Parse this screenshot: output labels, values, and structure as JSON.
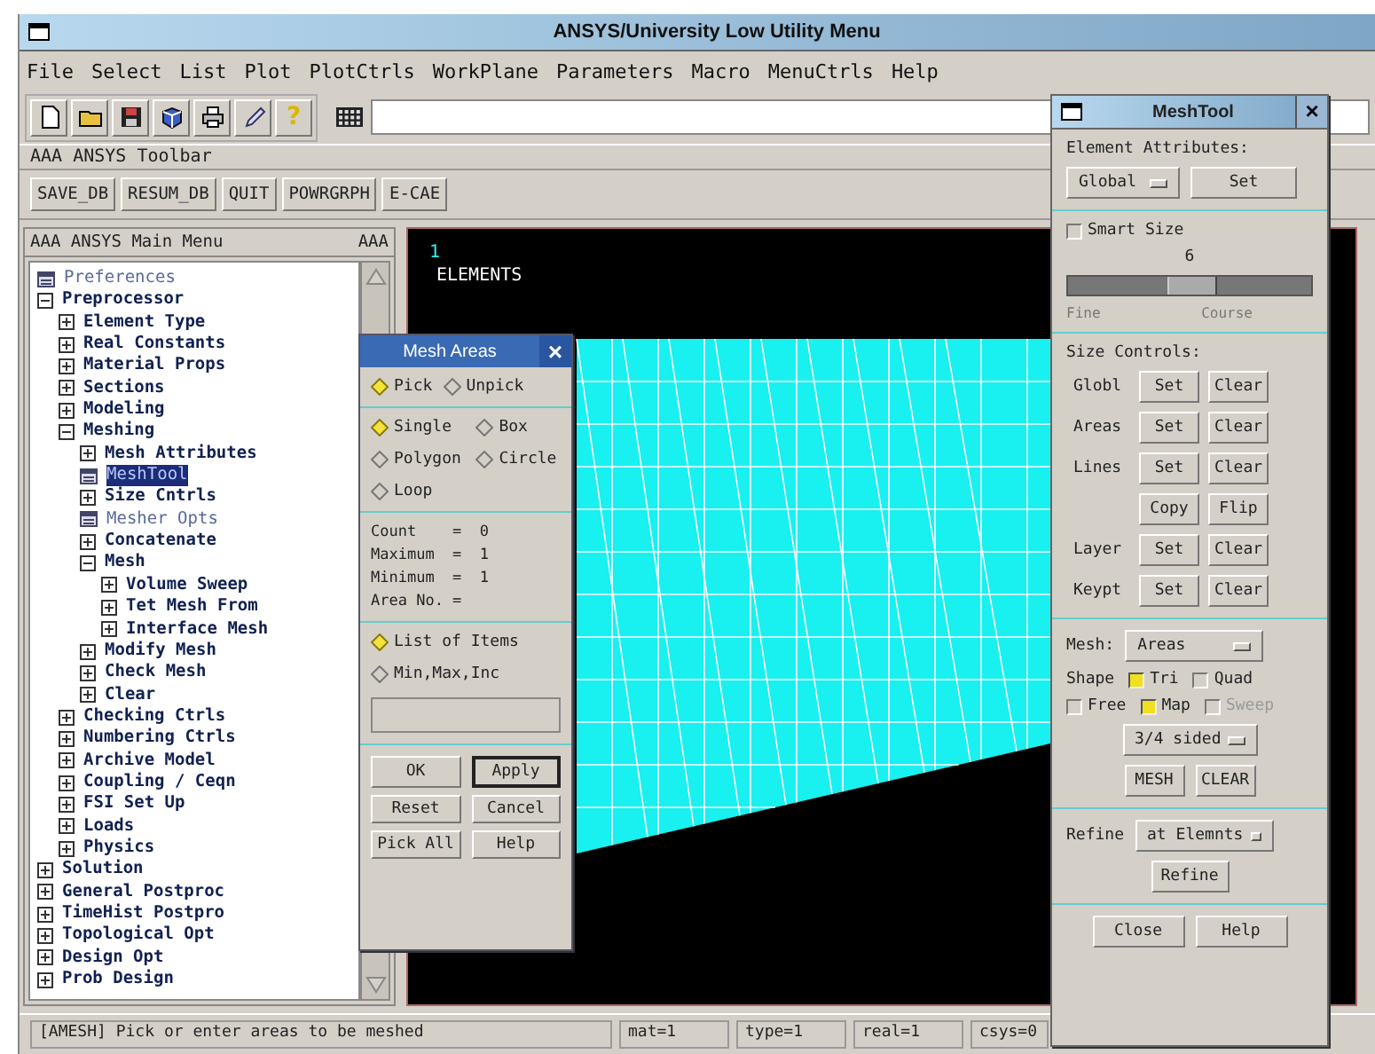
{
  "window": {
    "title": "ANSYS/University Low Utility Menu"
  },
  "menu_bar": [
    "File",
    "Select",
    "List",
    "Plot",
    "PlotCtrls",
    "WorkPlane",
    "Parameters",
    "Macro",
    "MenuCtrls",
    "Help"
  ],
  "toolbar": {
    "help_glyph": "?"
  },
  "ansys_toolbar": {
    "title": "AAA ANSYS Toolbar",
    "buttons": [
      "SAVE_DB",
      "RESUM_DB",
      "QUIT",
      "POWRGRPH",
      "E-CAE"
    ]
  },
  "main_menu": {
    "title": "AAA ANSYS Main Menu",
    "title_right": "AAA",
    "items": [
      {
        "label": "Preferences",
        "kind": "dialog",
        "selected": false
      },
      {
        "label": "Preprocessor",
        "kind": "folder",
        "expanded": true,
        "children": [
          {
            "label": "Element Type",
            "kind": "folder",
            "expanded": false
          },
          {
            "label": "Real Constants",
            "kind": "folder",
            "expanded": false
          },
          {
            "label": "Material Props",
            "kind": "folder",
            "expanded": false
          },
          {
            "label": "Sections",
            "kind": "folder",
            "expanded": false
          },
          {
            "label": "Modeling",
            "kind": "folder",
            "expanded": false
          },
          {
            "label": "Meshing",
            "kind": "folder",
            "expanded": true,
            "children": [
              {
                "label": "Mesh Attributes",
                "kind": "folder",
                "expanded": false
              },
              {
                "label": "MeshTool",
                "kind": "dialog",
                "selected": true
              },
              {
                "label": "Size Cntrls",
                "kind": "folder",
                "expanded": false
              },
              {
                "label": "Mesher Opts",
                "kind": "dialog",
                "selected": false
              },
              {
                "label": "Concatenate",
                "kind": "folder",
                "expanded": false
              },
              {
                "label": "Mesh",
                "kind": "folder",
                "expanded": true,
                "children": [
                  {
                    "label": "Volume Sweep",
                    "kind": "folder",
                    "expanded": false
                  },
                  {
                    "label": "Tet Mesh From",
                    "kind": "folder",
                    "expanded": false
                  },
                  {
                    "label": "Interface Mesh",
                    "kind": "folder",
                    "expanded": false
                  }
                ]
              },
              {
                "label": "Modify Mesh",
                "kind": "folder",
                "expanded": false
              },
              {
                "label": "Check Mesh",
                "kind": "folder",
                "expanded": false
              },
              {
                "label": "Clear",
                "kind": "folder",
                "expanded": false
              }
            ]
          },
          {
            "label": "Checking Ctrls",
            "kind": "folder",
            "expanded": false
          },
          {
            "label": "Numbering Ctrls",
            "kind": "folder",
            "expanded": false
          },
          {
            "label": "Archive Model",
            "kind": "folder",
            "expanded": false
          },
          {
            "label": "Coupling / Ceqn",
            "kind": "folder",
            "expanded": false
          },
          {
            "label": "FSI Set Up",
            "kind": "folder",
            "expanded": false
          },
          {
            "label": "Loads",
            "kind": "folder",
            "expanded": false
          },
          {
            "label": "Physics",
            "kind": "folder",
            "expanded": false
          }
        ]
      },
      {
        "label": "Solution",
        "kind": "folder",
        "expanded": false
      },
      {
        "label": "General Postproc",
        "kind": "folder",
        "expanded": false
      },
      {
        "label": "TimeHist Postpro",
        "kind": "folder",
        "expanded": false
      },
      {
        "label": "Topological Opt",
        "kind": "folder",
        "expanded": false
      },
      {
        "label": "Design Opt",
        "kind": "folder",
        "expanded": false
      },
      {
        "label": "Prob Design",
        "kind": "folder",
        "expanded": false
      }
    ]
  },
  "graphics": {
    "window_number": "1",
    "label": "ELEMENTS"
  },
  "mesh_areas": {
    "title": "Mesh Areas",
    "close": "×",
    "pick_mode": [
      {
        "label": "Pick",
        "selected": true
      },
      {
        "label": "Unpick",
        "selected": false
      }
    ],
    "pick_shape": [
      {
        "label": "Single",
        "selected": true
      },
      {
        "label": "Box",
        "selected": false
      },
      {
        "label": "Polygon",
        "selected": false
      },
      {
        "label": "Circle",
        "selected": false
      },
      {
        "label": "Loop",
        "selected": false
      }
    ],
    "info": [
      "Count    =  0",
      "Maximum  =  1",
      "Minimum  =  1",
      "Area No. ="
    ],
    "list_mode": [
      {
        "label": "List of Items",
        "selected": true
      },
      {
        "label": "Min,Max,Inc",
        "selected": false
      }
    ],
    "buttons": [
      "OK",
      "Apply",
      "Reset",
      "Cancel",
      "Pick All",
      "Help"
    ]
  },
  "mesh_tool": {
    "title": "MeshTool",
    "close": "×",
    "element_attributes": "Element Attributes:",
    "attr_dropdown": "Global",
    "attr_button": "Set",
    "smart_size": {
      "label": "Smart Size",
      "checked": false
    },
    "slider": {
      "value": "6",
      "level": 0.5,
      "min_label": "Fine",
      "max_label": "Course"
    },
    "size_controls": "Size Controls:",
    "size_rows": [
      {
        "label": "Globl",
        "buttons": [
          "Set",
          "Clear"
        ]
      },
      {
        "label": "Areas",
        "buttons": [
          "Set",
          "Clear"
        ]
      },
      {
        "label": "Lines",
        "buttons": [
          "Set",
          "Clear"
        ]
      },
      {
        "buttons": [
          "Copy",
          "Flip"
        ]
      },
      {
        "label": "Layer",
        "buttons": [
          "Set",
          "Clear"
        ]
      },
      {
        "label": "Keypt",
        "buttons": [
          "Set",
          "Clear"
        ]
      }
    ],
    "mesh_label": "Mesh:",
    "mesh_dropdown": "Areas",
    "shape_label": "Shape",
    "shape": [
      {
        "label": "Tri",
        "checked": true,
        "disabled": false
      },
      {
        "label": "Quad",
        "checked": false,
        "disabled": false
      }
    ],
    "method": [
      {
        "label": "Free",
        "checked": false,
        "disabled": false
      },
      {
        "label": "Map",
        "checked": true,
        "disabled": false
      },
      {
        "label": "Sweep",
        "checked": false,
        "disabled": true
      }
    ],
    "sided_dropdown": "3/4 sided",
    "mesh_buttons": [
      "MESH",
      "CLEAR"
    ],
    "refine_label": "Refine",
    "refine_dropdown": "at Elemnts",
    "refine_button": "Refine",
    "bottom_buttons": [
      "Close",
      "Help"
    ]
  },
  "status_bar": {
    "message": "[AMESH]  Pick or enter areas to be meshed",
    "fields": [
      "mat=1",
      "type=1",
      "real=1",
      "csys=0"
    ]
  }
}
